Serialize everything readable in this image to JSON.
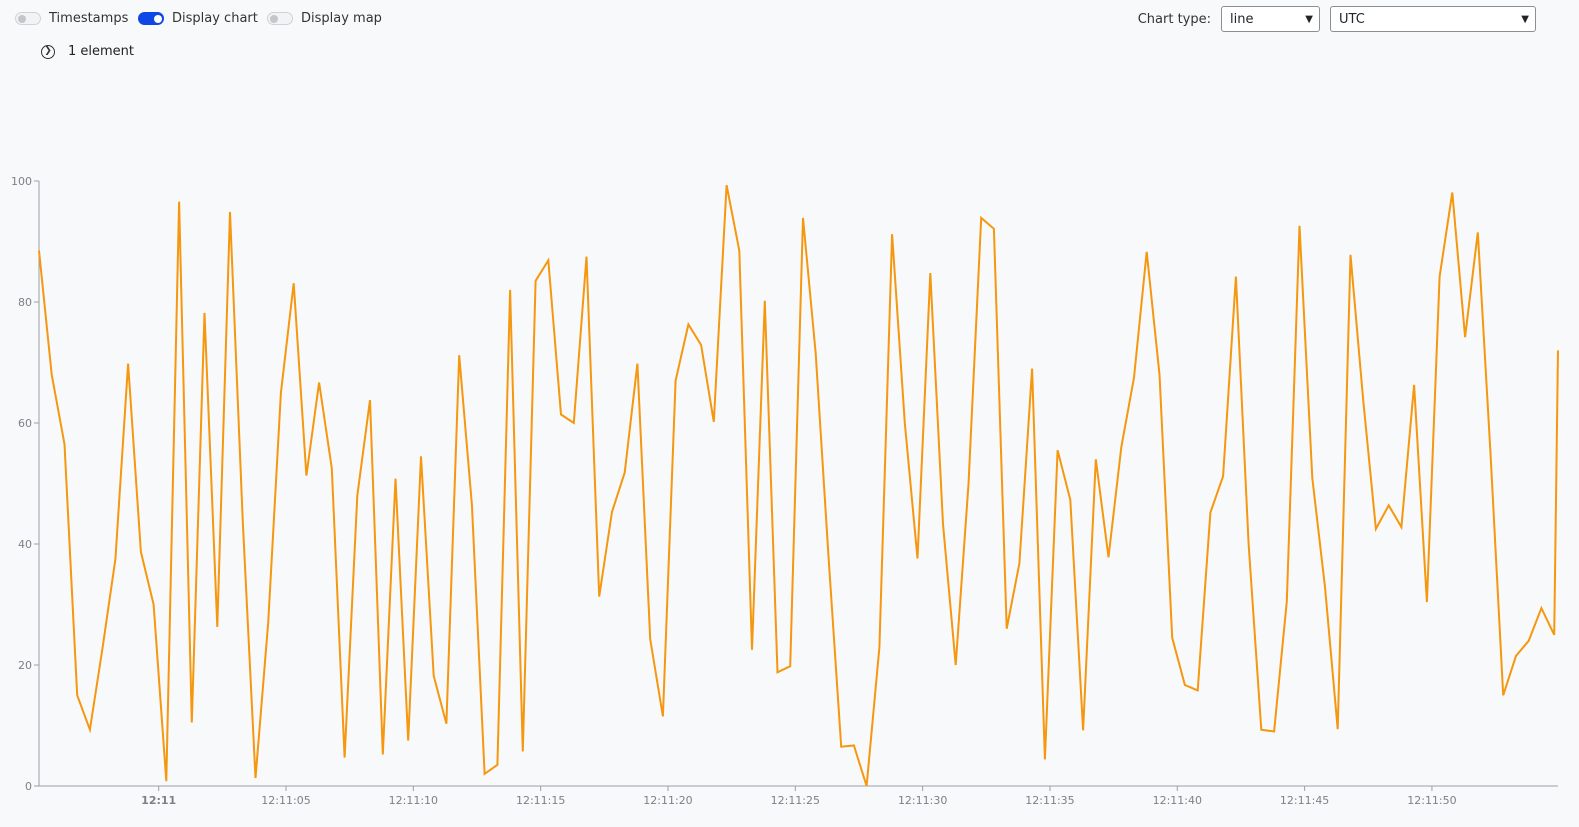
{
  "toolbar": {
    "timestamps_label": "Timestamps",
    "display_chart_label": "Display chart",
    "display_map_label": "Display map",
    "timestamps_on": false,
    "display_chart_on": true,
    "display_map_on": false,
    "chart_type_label": "Chart type:",
    "chart_type_value": "line",
    "timezone_value": "UTC"
  },
  "expander": {
    "label": "1 element"
  },
  "colors": {
    "line": "#f5970f",
    "toggle_on": "#0d47e6",
    "axis": "#9aa0a6"
  },
  "chart_data": {
    "type": "line",
    "title": "",
    "xlabel": "",
    "ylabel": "",
    "ylim": [
      0,
      100
    ],
    "y_ticks": [
      "0",
      "20",
      "40",
      "60",
      "80",
      "100"
    ],
    "x_ticks": [
      {
        "label": "12:11",
        "bold": true,
        "t": 0
      },
      {
        "label": "12:11:05",
        "bold": false,
        "t": 5
      },
      {
        "label": "12:11:10",
        "bold": false,
        "t": 10
      },
      {
        "label": "12:11:15",
        "bold": false,
        "t": 15
      },
      {
        "label": "12:11:20",
        "bold": false,
        "t": 20
      },
      {
        "label": "12:11:25",
        "bold": false,
        "t": 25
      },
      {
        "label": "12:11:30",
        "bold": false,
        "t": 30
      },
      {
        "label": "12:11:35",
        "bold": false,
        "t": 35
      },
      {
        "label": "12:11:40",
        "bold": false,
        "t": 40
      },
      {
        "label": "12:11:45",
        "bold": false,
        "t": 45
      },
      {
        "label": "12:11:50",
        "bold": false,
        "t": 50
      }
    ],
    "xlim": [
      -4.7,
      54.95
    ],
    "grid": false,
    "series": [
      {
        "x": [
          -4.7,
          -4.2,
          -3.7,
          -3.2,
          -2.7,
          -2.2,
          -1.7,
          -1.2,
          -0.7,
          -0.2,
          0.3,
          0.8,
          1.3,
          1.8,
          2.3,
          2.8,
          3.3,
          3.8,
          4.3,
          4.8,
          5.3,
          5.8,
          6.3,
          6.8,
          7.3,
          7.8,
          8.3,
          8.8,
          9.3,
          9.8,
          10.3,
          10.8,
          11.3,
          11.8,
          12.3,
          12.8,
          13.3,
          13.8,
          14.3,
          14.8,
          15.3,
          15.8,
          16.3,
          16.8,
          17.3,
          17.8,
          18.3,
          18.8,
          19.3,
          19.8,
          20.3,
          20.8,
          21.3,
          21.8,
          22.3,
          22.8,
          23.3,
          23.8,
          24.3,
          24.8,
          25.3,
          25.8,
          26.3,
          26.8,
          27.3,
          27.8,
          28.3,
          28.8,
          29.3,
          29.8,
          30.3,
          30.8,
          31.3,
          31.8,
          32.3,
          32.8,
          33.3,
          33.8,
          34.3,
          34.8,
          35.3,
          35.8,
          36.3,
          36.8,
          37.3,
          37.8,
          38.3,
          38.8,
          39.3,
          39.8,
          40.3,
          40.8,
          41.3,
          41.8,
          42.3,
          42.8,
          43.3,
          43.8,
          44.3,
          44.8,
          45.3,
          45.8,
          46.3,
          46.8,
          47.3,
          47.8,
          48.3,
          48.8,
          49.3,
          49.8,
          50.3,
          50.8,
          51.3,
          51.8,
          52.3,
          52.8,
          53.3,
          53.8,
          54.3,
          54.8,
          54.95
        ],
        "values": [
          88.5,
          68,
          56.5,
          15,
          9.3,
          23,
          37.5,
          69.8,
          38.7,
          30,
          0.8,
          96.6,
          10.5,
          78.2,
          26.3,
          94.9,
          44,
          1.3,
          27,
          65,
          83.1,
          51.3,
          66.7,
          52.5,
          4.7,
          48,
          63.8,
          5.2,
          50.8,
          7.5,
          54.5,
          18.2,
          10.3,
          71.2,
          46.5,
          2,
          3.5,
          82,
          5.7,
          83.5,
          86.9,
          61.4,
          60,
          87.5,
          31.3,
          45.3,
          51.8,
          69.8,
          24.3,
          11.5,
          67,
          76.3,
          72.9,
          60.2,
          99.3,
          88.5,
          22.5,
          80.2,
          18.8,
          19.8,
          93.9,
          71.5,
          38.2,
          6.5,
          6.7,
          0,
          22.9,
          91.2,
          60,
          37.6,
          84.8,
          43.3,
          20,
          49.9,
          93.9,
          92.1,
          26,
          36.8,
          69,
          4.4,
          55.5,
          47.3,
          9.2,
          54,
          37.8,
          56,
          67.5,
          88.3,
          68,
          24.5,
          16.7,
          15.8,
          45.2,
          51.2,
          84.2,
          40,
          9.3,
          9,
          30.5,
          92.6,
          50.9,
          32.9,
          9.4,
          87.8,
          63.8,
          42.5,
          46.4,
          42.8,
          66.3,
          30.4,
          84.2,
          98.1,
          74.2,
          91.5,
          55,
          15,
          21.5,
          24,
          29.4,
          25,
          72
        ]
      }
    ]
  }
}
